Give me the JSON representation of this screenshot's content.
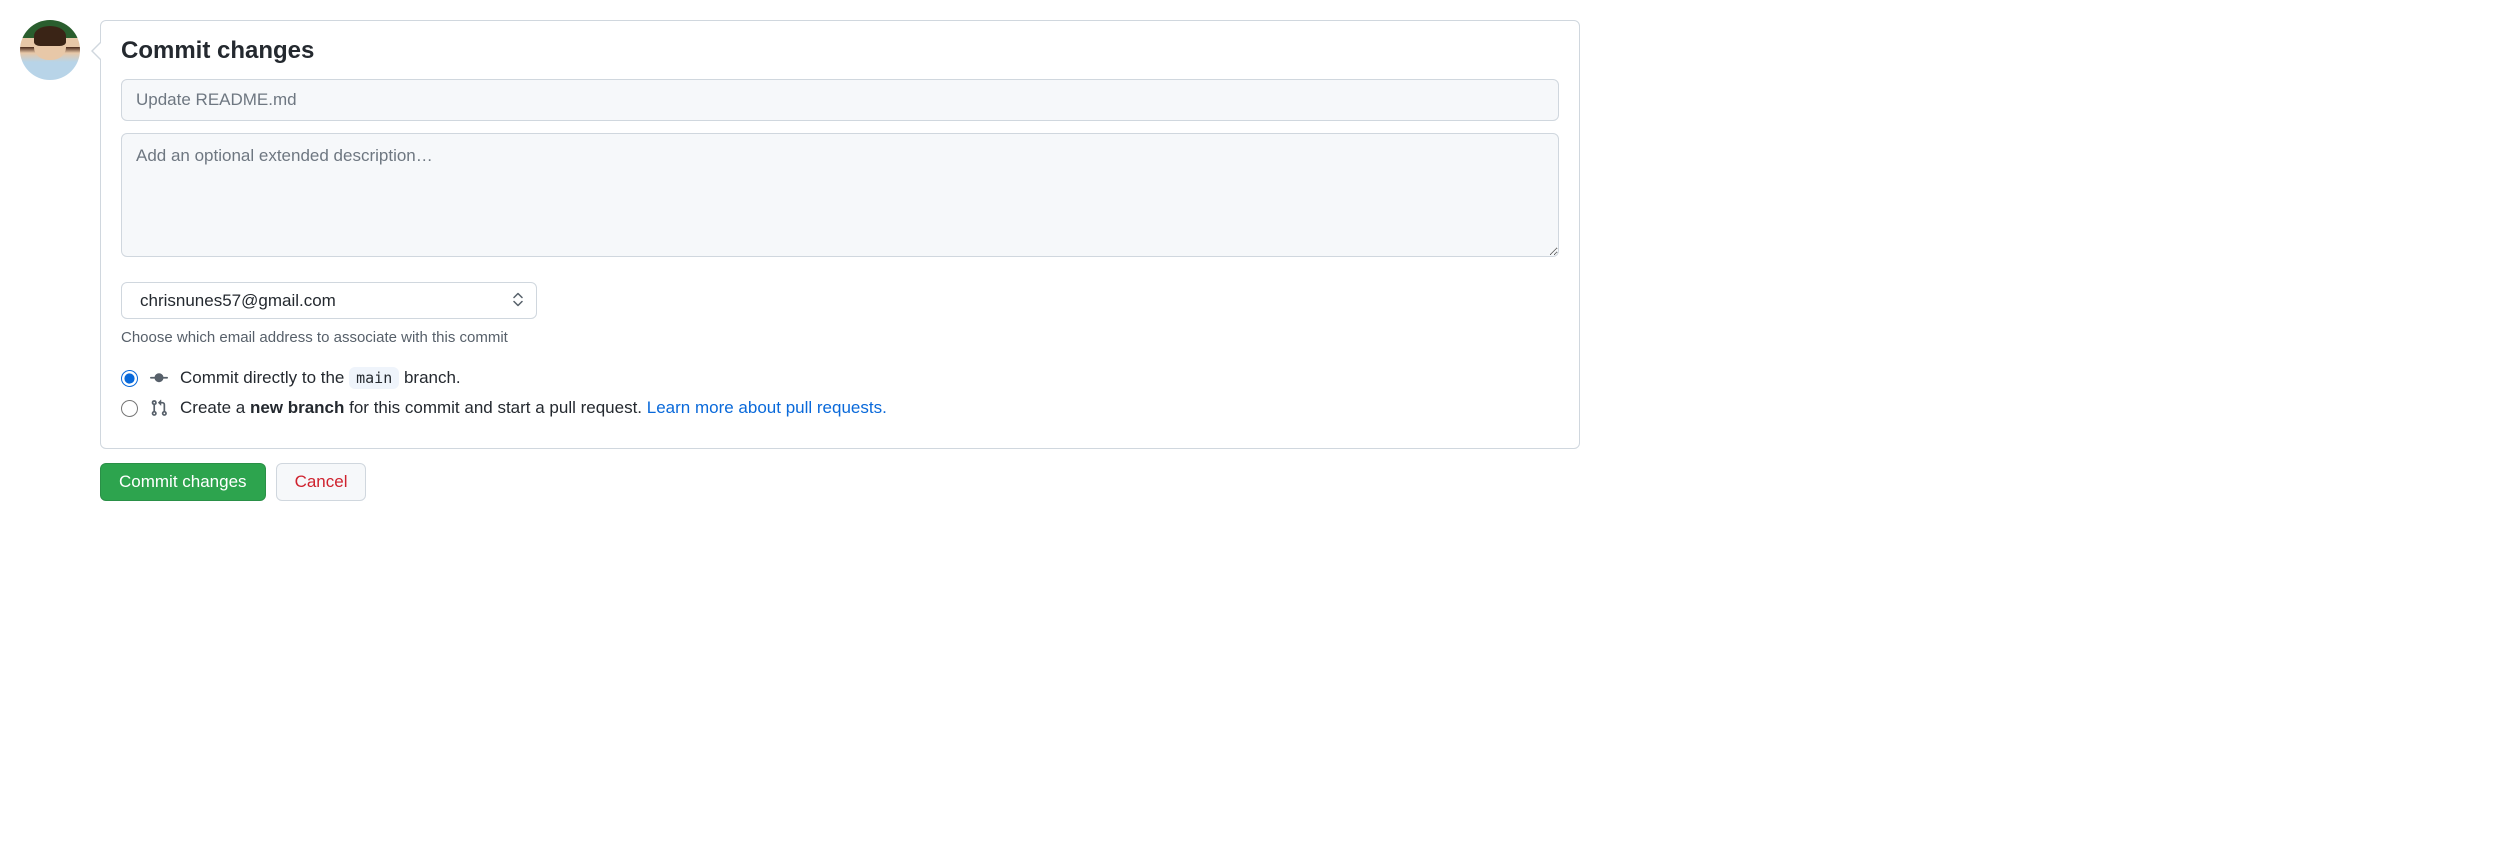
{
  "heading": "Commit changes",
  "summary": {
    "placeholder": "Update README.md",
    "value": ""
  },
  "description": {
    "placeholder": "Add an optional extended description…",
    "value": ""
  },
  "email": {
    "selected": "chrisnunes57@gmail.com",
    "helper": "Choose which email address to associate with this commit"
  },
  "options": {
    "direct": {
      "prefix": "Commit directly to the ",
      "branch": "main",
      "suffix": " branch."
    },
    "newbranch": {
      "prefix": "Create a ",
      "bold": "new branch",
      "middle": " for this commit and start a pull request. ",
      "link": "Learn more about pull requests."
    }
  },
  "buttons": {
    "commit": "Commit changes",
    "cancel": "Cancel"
  }
}
